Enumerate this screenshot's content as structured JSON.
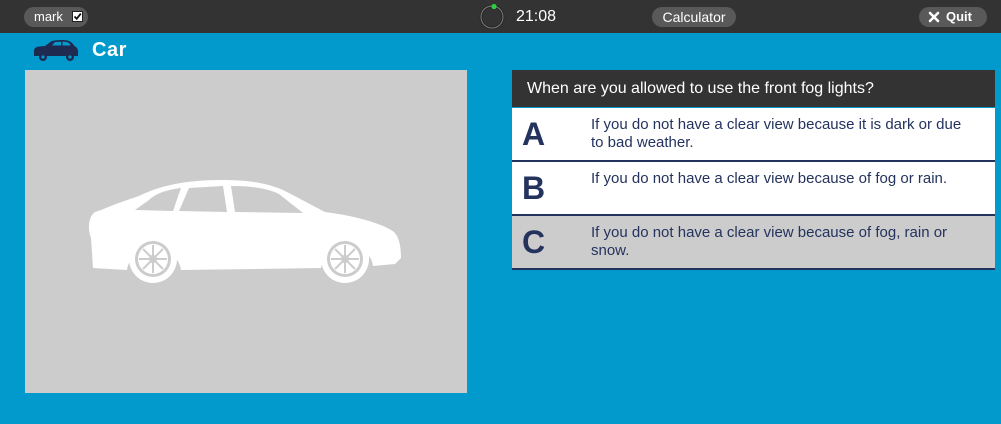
{
  "topbar": {
    "mark_label": "mark",
    "mark_checked": true,
    "timer": "21:08",
    "calculator_label": "Calculator",
    "quit_label": "Quit"
  },
  "category": {
    "icon": "car-icon",
    "title": "Car"
  },
  "question": {
    "text": "When are you allowed to use the front fog lights?"
  },
  "answers": [
    {
      "letter": "A",
      "text": "If you do not have a clear view because it is dark or due to bad weather."
    },
    {
      "letter": "B",
      "text": "If you do not have a clear view because of fog or rain."
    },
    {
      "letter": "C",
      "text": "If you do not have a clear view because of fog, rain or snow."
    }
  ],
  "colors": {
    "background": "#0299cd",
    "topbar": "#333333",
    "pill": "#595959",
    "answer_text": "#24335e",
    "image_bg": "#cccccc",
    "timer_progress": "#2ecc40"
  }
}
